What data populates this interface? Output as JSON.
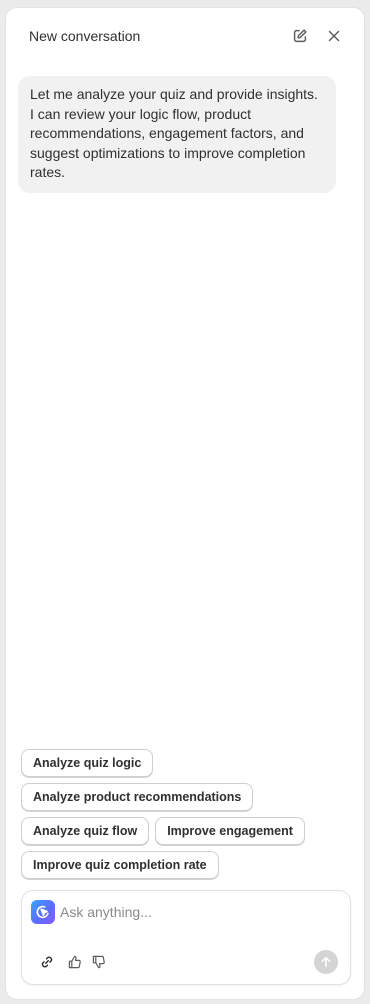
{
  "header": {
    "title": "New conversation",
    "actions": [
      {
        "icon": "compose-icon",
        "label": "New chat"
      },
      {
        "icon": "close-icon",
        "label": "Close"
      }
    ]
  },
  "message": {
    "role": "assistant",
    "text": "Let me analyze your quiz and provide insights. I can review your logic flow, product recommendations, engagement factors, and suggest optimizations to improve completion rates."
  },
  "suggestions": [
    "Analyze quiz logic",
    "Analyze product recommendations",
    "Analyze quiz flow",
    "Improve engagement",
    "Improve quiz completion rate"
  ],
  "composer": {
    "placeholder": "Ask anything...",
    "value": "",
    "tools": [
      "link-icon",
      "thumbs-up-icon",
      "thumbs-down-icon"
    ],
    "send_icon": "arrow-up-icon"
  },
  "colors": {
    "background": "#ebebeb",
    "panel": "#ffffff",
    "bubble": "#f1f1f1",
    "text": "#303030",
    "send_disabled": "#d4d4d4"
  }
}
